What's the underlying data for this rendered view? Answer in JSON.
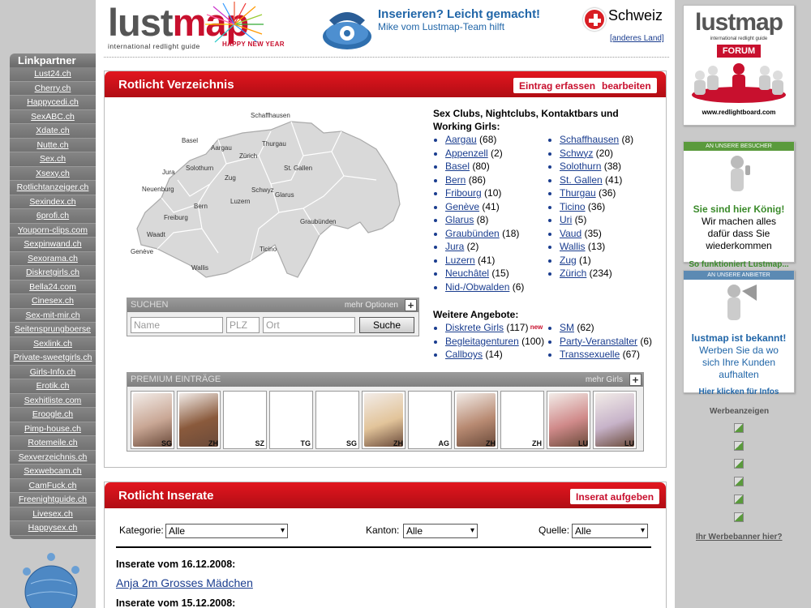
{
  "header": {
    "logo_main": "lust",
    "logo_accent": "map",
    "logo_sub": "international redlight guide",
    "logo_greeting": "HAPPY NEW YEAR",
    "promo_title": "Inserieren? Leicht gemacht!",
    "promo_sub": "Mike vom Lustmap-Team hilft",
    "country": "Schweiz",
    "change_country": "[anderes Land]"
  },
  "linkpartner": {
    "title": "Linkpartner",
    "items": [
      "Lust24.ch",
      "Cherry.ch",
      "Happycedi.ch",
      "SexABC.ch",
      "Xdate.ch",
      "Nutte.ch",
      "Sex.ch",
      "Xsexy.ch",
      "Rotlichtanzeiger.ch",
      "Sexindex.ch",
      "6profi.ch",
      "Youporn-clips.com",
      "Sexpinwand.ch",
      "Sexorama.ch",
      "Diskretgirls.ch",
      "Bella24.com",
      "Cinesex.ch",
      "Sex-mit-mir.ch",
      "Seitensprungboerse",
      "Sexlink.ch",
      "Private-sweetgirls.ch",
      "Girls-Info.ch",
      "Erotik.ch",
      "Sexhitliste.com",
      "Eroogle.ch",
      "Pimp-house.ch",
      "Rotemeile.ch",
      "Sexverzeichnis.ch",
      "Sexwebcam.ch",
      "CamFuck.ch",
      "Freenightguide.ch",
      "Livesex.ch",
      "Happysex.ch"
    ]
  },
  "verzeichnis": {
    "title": "Rotlicht Verzeichnis",
    "btn_add": "Eintrag erfassen",
    "btn_edit": "bearbeiten",
    "map_labels": [
      "Schaffhausen",
      "Basel",
      "Thurgau",
      "Aargau",
      "Zürich",
      "Jura",
      "Solothurn",
      "St. Gallen",
      "Zug",
      "Neuenburg",
      "Schwyz",
      "Glarus",
      "Luzern",
      "Bern",
      "Freiburg",
      "Graubünden",
      "Waadt",
      "Ticino",
      "Genève",
      "Wallis"
    ],
    "list_title": "Sex Clubs, Nightclubs, Kontaktbars und Working Girls:",
    "col1": [
      {
        "name": "Aargau",
        "count": "(68)"
      },
      {
        "name": "Appenzell",
        "count": "(2)"
      },
      {
        "name": "Basel",
        "count": "(80)"
      },
      {
        "name": "Bern",
        "count": "(86)"
      },
      {
        "name": "Fribourg",
        "count": "(10)"
      },
      {
        "name": "Genève",
        "count": "(41)"
      },
      {
        "name": "Glarus",
        "count": "(8)"
      },
      {
        "name": "Graubünden",
        "count": "(18)"
      },
      {
        "name": "Jura",
        "count": "(2)"
      },
      {
        "name": "Luzern",
        "count": "(41)"
      },
      {
        "name": "Neuchâtel",
        "count": "(15)"
      },
      {
        "name": "Nid-/Obwalden",
        "count": "(6)"
      }
    ],
    "col2": [
      {
        "name": "Schaffhausen",
        "count": "(8)"
      },
      {
        "name": "Schwyz",
        "count": "(20)"
      },
      {
        "name": "Solothurn",
        "count": "(38)"
      },
      {
        "name": "St. Gallen",
        "count": "(41)"
      },
      {
        "name": "Thurgau",
        "count": "(36)"
      },
      {
        "name": "Ticino",
        "count": "(36)"
      },
      {
        "name": "Uri",
        "count": "(5)"
      },
      {
        "name": "Vaud",
        "count": "(35)"
      },
      {
        "name": "Wallis",
        "count": "(13)"
      },
      {
        "name": "Zug",
        "count": "(1)"
      },
      {
        "name": "Zürich",
        "count": "(234)"
      }
    ],
    "more_title": "Weitere Angebote:",
    "more_col1": [
      {
        "name": "Diskrete Girls",
        "count": "(117)",
        "badge": "new"
      },
      {
        "name": "Begleitagenturen",
        "count": "(100)"
      },
      {
        "name": "Callboys",
        "count": "(14)"
      }
    ],
    "more_col2": [
      {
        "name": "SM",
        "count": "(62)"
      },
      {
        "name": "Party-Veranstalter",
        "count": "(6)"
      },
      {
        "name": "Transsexuelle",
        "count": "(67)"
      }
    ]
  },
  "search": {
    "title": "SUCHEN",
    "more": "mehr Optionen",
    "plus": "+",
    "name_placeholder": "Name",
    "plz_placeholder": "PLZ",
    "ort_placeholder": "Ort",
    "button": "Suche"
  },
  "premium": {
    "title": "PREMIUM EINTRÄGE",
    "more": "mehr Girls",
    "plus": "+",
    "thumbs": [
      {
        "tag": "SG",
        "color": "#c9a795"
      },
      {
        "tag": "ZH",
        "color": "#8a5a3c"
      },
      {
        "tag": "SZ",
        "color": ""
      },
      {
        "tag": "TG",
        "color": ""
      },
      {
        "tag": "SG",
        "color": ""
      },
      {
        "tag": "ZH",
        "color": "#e2c49a"
      },
      {
        "tag": "AG",
        "color": ""
      },
      {
        "tag": "ZH",
        "color": "#b88a72"
      },
      {
        "tag": "ZH",
        "color": ""
      },
      {
        "tag": "LU",
        "color": "#d08a8a"
      },
      {
        "tag": "LU",
        "color": "#c7b3c9"
      }
    ]
  },
  "inserate": {
    "title": "Rotlicht Inserate",
    "btn_add": "Inserat aufgeben",
    "kategorie_label": "Kategorie:",
    "kategorie_value": "Alle",
    "kanton_label": "Kanton:",
    "kanton_value": "Alle",
    "quelle_label": "Quelle:",
    "quelle_value": "Alle",
    "date1": "Inserate vom 16.12.2008:",
    "entry1": "Anja 2m Grosses Mädchen",
    "date2": "Inserate vom 15.12.2008:"
  },
  "right": {
    "logo_main": "lustmap",
    "logo_sub": "international redlight guide",
    "forum": "FORUM",
    "forum_url": "www.redlightboard.com",
    "visitors_head": "AN UNSERE BESUCHER",
    "visitors_green": "Sie sind hier König!",
    "visitors_text": "Wir machen alles dafür dass Sie wiederkommen",
    "visitors_link": "So funktioniert Lustmap...",
    "provider_head": "AN UNSERE ANBIETER",
    "provider_blue": "lustmap ist bekannt!",
    "provider_text": "Werben Sie da wo sich Ihre Kunden aufhalten",
    "provider_link": "Hier klicken für Infos",
    "ads_label": "Werbeanzeigen",
    "ads_question": "Ihr Werbebanner hier?"
  }
}
